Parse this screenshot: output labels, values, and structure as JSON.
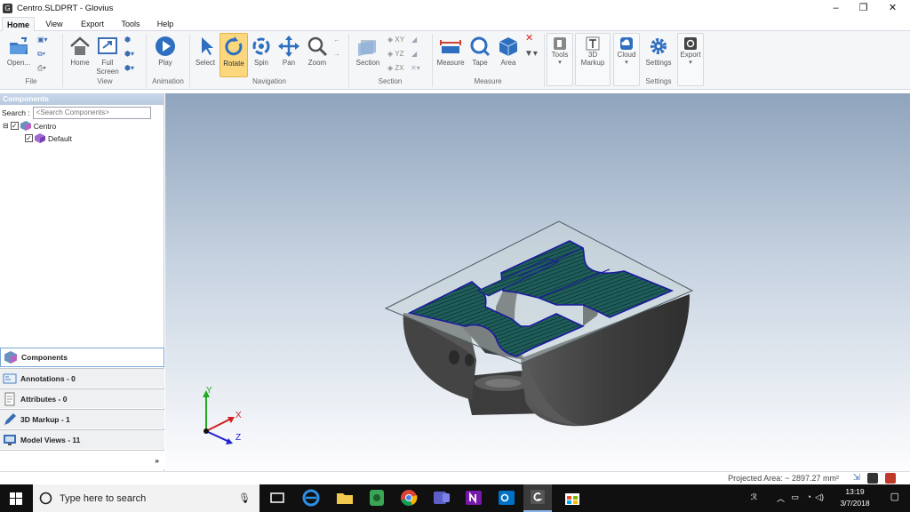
{
  "titlebar": {
    "icon": "G",
    "title": "Centro.SLDPRT - Glovius",
    "minimize": "–",
    "maximize": "❐",
    "close": "✕"
  },
  "menu": {
    "tabs": [
      "Home",
      "View",
      "Export",
      "Tools",
      "Help"
    ],
    "active": "Home"
  },
  "ribbon": {
    "file": {
      "open": "Open...",
      "group": "File"
    },
    "view": {
      "home": "Home",
      "full_screen_1": "Full",
      "full_screen_2": "Screen",
      "group": "View"
    },
    "animation": {
      "play": "Play",
      "group": "Animation"
    },
    "navigation": {
      "select": "Select",
      "rotate": "Rotate",
      "spin": "Spin",
      "pan": "Pan",
      "zoom": "Zoom",
      "group": "Navigation"
    },
    "section": {
      "section": "Section",
      "xy": "XY",
      "yz": "YZ",
      "zx": "ZX",
      "group": "Section"
    },
    "measure": {
      "measure": "Measure",
      "tape": "Tape",
      "area": "Area",
      "group": "Measure"
    },
    "tools": {
      "tools": "Tools",
      "markup_1": "3D",
      "markup_2": "Markup",
      "cloud": "Cloud",
      "settings": "Settings",
      "export": "Export",
      "group": "Settings"
    }
  },
  "leftpanel": {
    "header": "Components",
    "search_label": "Search :",
    "search_placeholder": "<Search Components>",
    "tree": [
      {
        "label": "Centro"
      },
      {
        "label": "Default"
      }
    ],
    "nav": [
      {
        "label": "Components"
      },
      {
        "label": "Annotations - 0"
      },
      {
        "label": "Attributes - 0"
      },
      {
        "label": "3D Markup - 1"
      },
      {
        "label": "Model Views - 11"
      }
    ],
    "expand": "»"
  },
  "axes": {
    "x": "X",
    "y": "Y",
    "z": "Z"
  },
  "status": {
    "projected_area": "Projected Area: ~ 2897.27 mm²"
  },
  "taskbar": {
    "search_placeholder": "Type here to search",
    "time": "13:19",
    "date": "3/7/2018"
  },
  "colors": {
    "accent": "#fbd77d",
    "viewport_top": "#8fa4bd",
    "hatch": "#1f5e5a",
    "outline": "#1a1aa0"
  }
}
